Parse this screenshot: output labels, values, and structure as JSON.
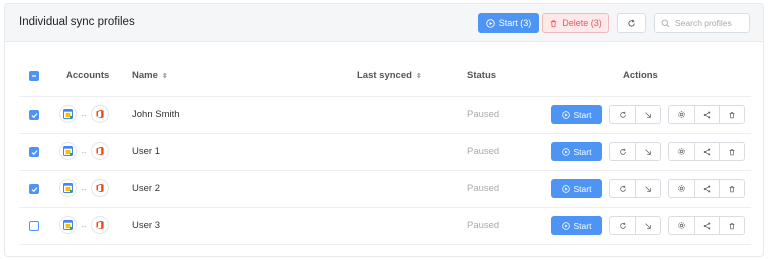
{
  "header": {
    "title": "Individual sync profiles",
    "start_selected_label": "Start (3)",
    "delete_selected_label": "Delete (3)",
    "search_placeholder": "Search profiles"
  },
  "columns": {
    "accounts": "Accounts",
    "name": "Name",
    "last_synced": "Last synced",
    "status": "Status",
    "actions": "Actions"
  },
  "row_start_label": "Start",
  "rows": [
    {
      "name": "John Smith",
      "last_synced": "",
      "status": "Paused",
      "checked": true
    },
    {
      "name": "User 1",
      "last_synced": "",
      "status": "Paused",
      "checked": true
    },
    {
      "name": "User 2",
      "last_synced": "",
      "status": "Paused",
      "checked": true
    },
    {
      "name": "User 3",
      "last_synced": "",
      "status": "Paused",
      "checked": false
    }
  ],
  "colors": {
    "accent": "#4d94f5",
    "danger": "#e05a62",
    "danger_bg": "#fde9ea",
    "status_gray": "#aaaaaa"
  },
  "icons": {
    "left_account": "google-calendar-icon",
    "right_account": "office-icon"
  }
}
